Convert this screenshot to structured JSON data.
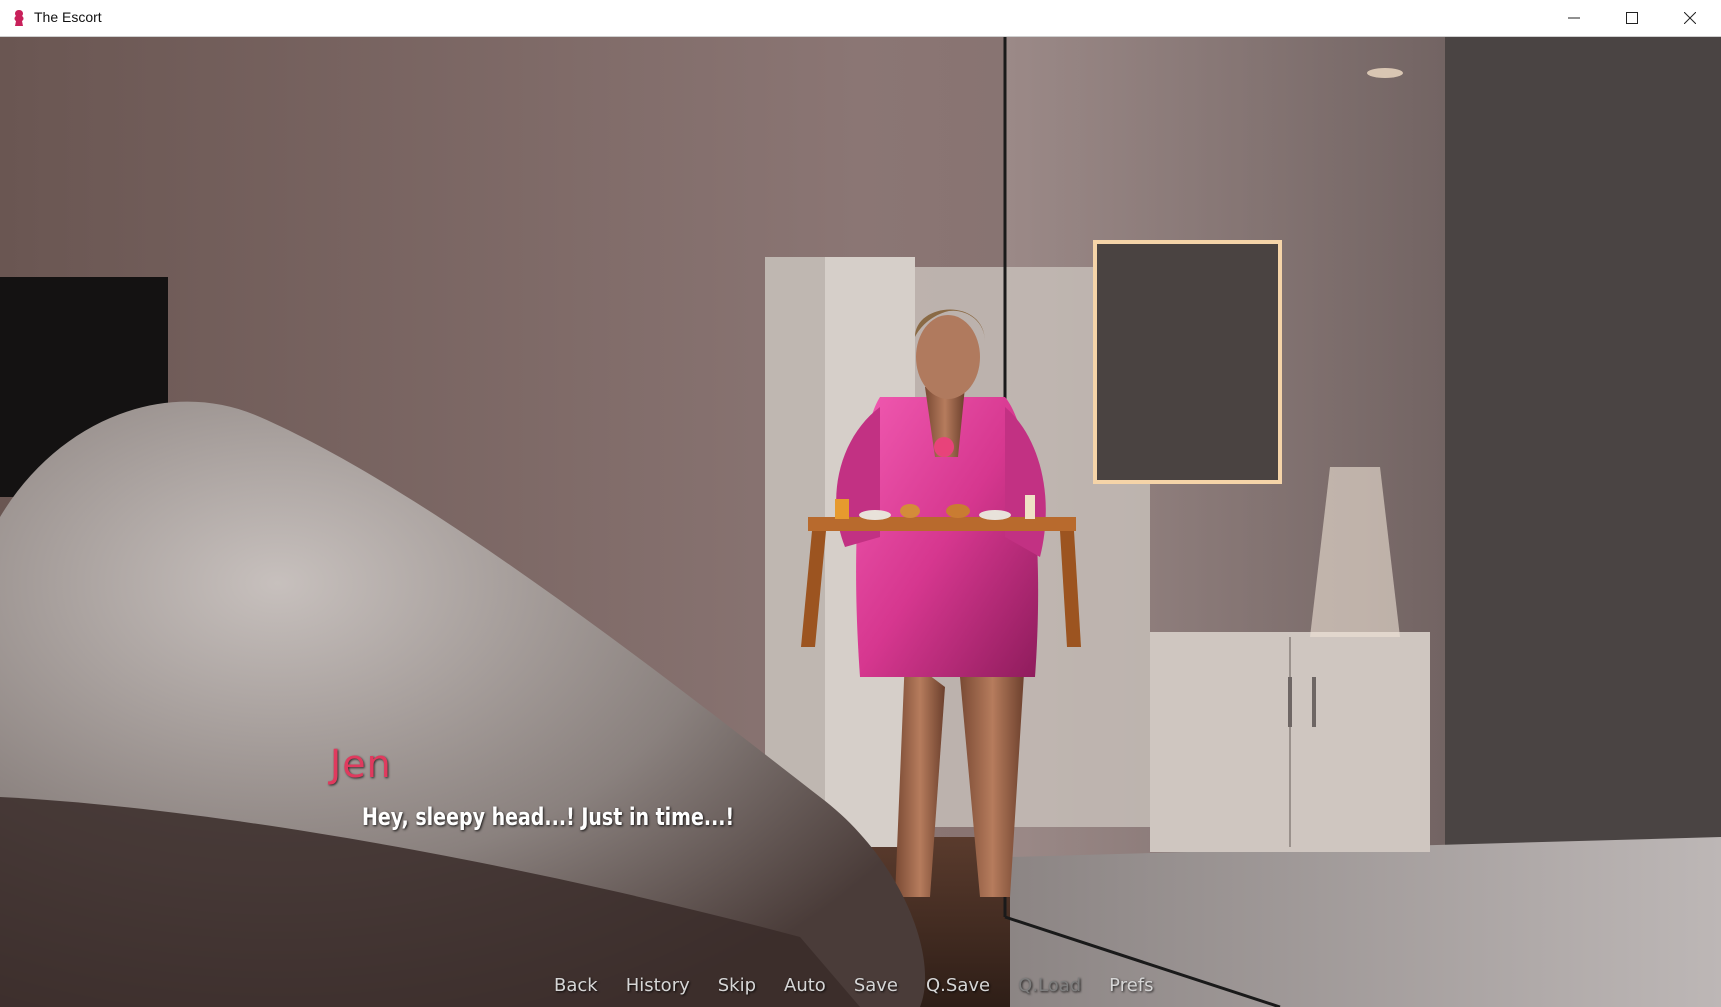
{
  "window": {
    "title": "The Escort",
    "controls": [
      "minimize",
      "maximize",
      "close"
    ]
  },
  "dialogue": {
    "speaker": "Jen",
    "speaker_color": "#e03a5e",
    "line": "Hey, sleepy head...! Just in time...!"
  },
  "quick_menu": {
    "items": [
      {
        "label": "Back",
        "enabled": true
      },
      {
        "label": "History",
        "enabled": true
      },
      {
        "label": "Skip",
        "enabled": true
      },
      {
        "label": "Auto",
        "enabled": true
      },
      {
        "label": "Save",
        "enabled": true
      },
      {
        "label": "Q.Save",
        "enabled": true
      },
      {
        "label": "Q.Load",
        "enabled": false
      },
      {
        "label": "Prefs",
        "enabled": true
      }
    ]
  },
  "icons": {
    "app": "pink-silhouette-icon"
  },
  "colors": {
    "robe": "#d6378f",
    "quickmenu_text": "#d6d6d6",
    "quickmenu_disabled": "#7d7d7d"
  }
}
